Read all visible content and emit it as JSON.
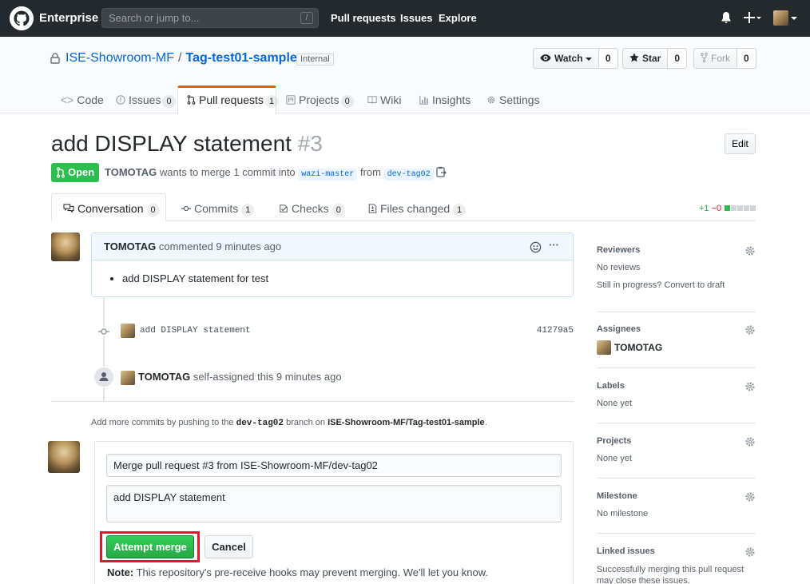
{
  "header": {
    "brand": "Enterprise",
    "search_placeholder": "Search or jump to...",
    "search_key": "/",
    "nav": [
      "Pull requests",
      "Issues",
      "Explore"
    ]
  },
  "repo": {
    "owner": "ISE-Showroom-MF",
    "name": "Tag-test01-sample",
    "visibility": "Internal",
    "watch_label": "Watch",
    "watch_count": "0",
    "star_label": "Star",
    "star_count": "0",
    "fork_label": "Fork",
    "fork_count": "0",
    "tabs": [
      {
        "label": "Code",
        "count": ""
      },
      {
        "label": "Issues",
        "count": "0"
      },
      {
        "label": "Pull requests",
        "count": "1"
      },
      {
        "label": "Projects",
        "count": "0"
      },
      {
        "label": "Wiki",
        "count": ""
      },
      {
        "label": "Insights",
        "count": ""
      },
      {
        "label": "Settings",
        "count": ""
      }
    ]
  },
  "pr": {
    "title": "add DISPLAY statement",
    "number": "#3",
    "edit_label": "Edit",
    "state": "Open",
    "author": "TOMOTAG",
    "meta_text": "wants to merge 1 commit into",
    "base_branch": "wazi-master",
    "from_text": "from",
    "head_branch": "dev-tag02",
    "tabs": [
      {
        "label": "Conversation",
        "count": "0"
      },
      {
        "label": "Commits",
        "count": "1"
      },
      {
        "label": "Checks",
        "count": "0"
      },
      {
        "label": "Files changed",
        "count": "1"
      }
    ],
    "diff_add": "+1",
    "diff_del": "−0"
  },
  "timeline": {
    "comment_author": "TOMOTAG",
    "comment_meta": "commented 9 minutes ago",
    "comment_item": "add DISPLAY statement for test",
    "commit_message": "add DISPLAY statement",
    "commit_sha": "41279a5",
    "event_author": "TOMOTAG",
    "event_text": "self-assigned this 9 minutes ago",
    "push_hint_prefix": "Add more commits by pushing to the",
    "push_hint_branch": "dev-tag02",
    "push_hint_mid": "branch on",
    "push_hint_repo": "ISE-Showroom-MF/Tag-test01-sample",
    "push_hint_suffix": "."
  },
  "merge": {
    "title_value": "Merge pull request #3 from ISE-Showroom-MF/dev-tag02",
    "body_value": "add DISPLAY statement",
    "confirm_label": "Attempt merge",
    "cancel_label": "Cancel",
    "note_label": "Note:",
    "note_text": "This repository's pre-receive hooks may prevent merging. We'll let you know."
  },
  "sidebar": {
    "reviewers_title": "Reviewers",
    "reviewers_value": "No reviews",
    "reviewers_hint": "Still in progress? Convert to draft",
    "assignees_title": "Assignees",
    "assignee": "TOMOTAG",
    "labels_title": "Labels",
    "labels_value": "None yet",
    "projects_title": "Projects",
    "projects_value": "None yet",
    "milestone_title": "Milestone",
    "milestone_value": "No milestone",
    "linked_title": "Linked issues",
    "linked_value": "Successfully merging this pull request may close these issues."
  },
  "colors": {
    "header_bg": "#24292e",
    "link": "#0366d6",
    "open_green": "#2cbe4e",
    "merge_green": "#28a745",
    "highlight_red": "#e0182d",
    "tab_accent": "#e36209"
  }
}
